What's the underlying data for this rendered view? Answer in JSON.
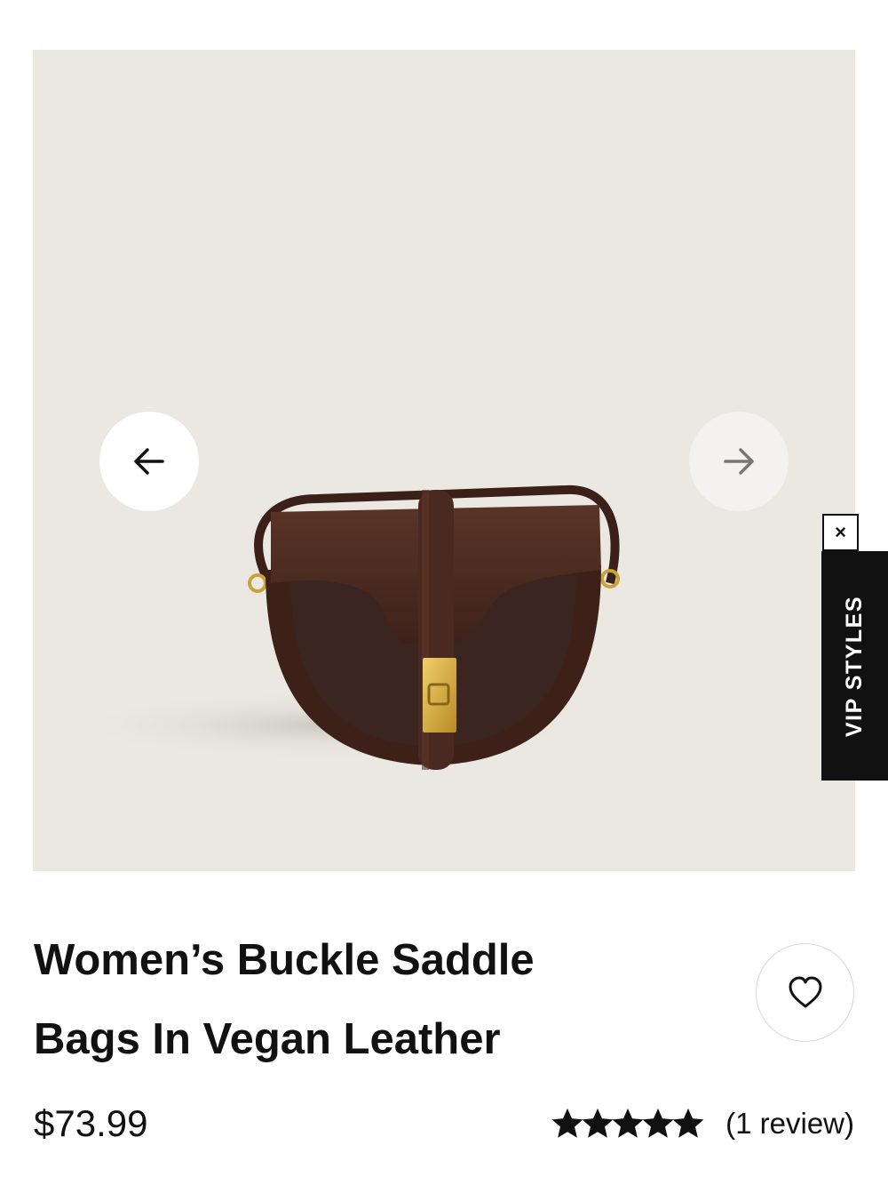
{
  "gallery": {
    "image_alt": "Brown saddle bag with gold buckle",
    "prev_label": "←",
    "next_label": "→"
  },
  "vip": {
    "label": "VIP STYLES",
    "close_label": "×"
  },
  "product": {
    "title_line1": "Women’s Buckle Saddle",
    "title_line2": "Bags In Vegan Leather",
    "price": "$73.99",
    "rating_stars": 5,
    "rating_max": 5,
    "review_text": "(1 review)"
  },
  "colors": {
    "gallery_bg": "#ebe8e2",
    "bag_brown": "#4a2a20",
    "buckle_gold": "#d4a93a",
    "vip_bg": "#111111"
  }
}
